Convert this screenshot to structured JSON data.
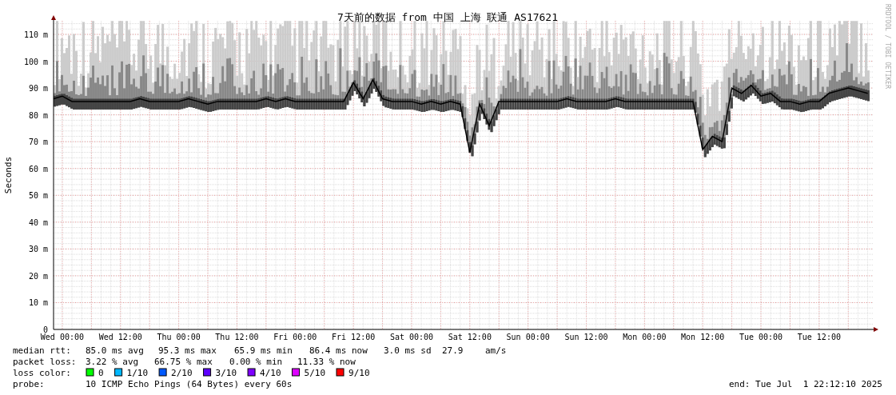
{
  "graph": {
    "title": "7天前的数据 from 中国 上海 联通 AS17621",
    "credit": "RRDTOOL / TOBI OETIKER",
    "chart_data": {
      "type": "line",
      "grid": true,
      "ylabel": "Seconds",
      "ylim": [
        0,
        115
      ],
      "yticks": [
        {
          "value": 0,
          "label": "0"
        },
        {
          "value": 10,
          "label": "10 m"
        },
        {
          "value": 20,
          "label": "20 m"
        },
        {
          "value": 30,
          "label": "30 m"
        },
        {
          "value": 40,
          "label": "40 m"
        },
        {
          "value": 50,
          "label": "50 m"
        },
        {
          "value": 60,
          "label": "60 m"
        },
        {
          "value": 70,
          "label": "70 m"
        },
        {
          "value": 80,
          "label": "80 m"
        },
        {
          "value": 90,
          "label": "90 m"
        },
        {
          "value": 100,
          "label": "100 m"
        },
        {
          "value": 110,
          "label": "110 m"
        }
      ],
      "categories": [
        null,
        "Wed 00:00",
        null,
        null,
        null,
        null,
        null,
        "Wed 12:00",
        null,
        null,
        null,
        null,
        null,
        "Thu 00:00",
        null,
        null,
        null,
        null,
        null,
        "Thu 12:00",
        null,
        null,
        null,
        null,
        null,
        "Fri 00:00",
        null,
        null,
        null,
        null,
        null,
        "Fri 12:00",
        null,
        null,
        null,
        null,
        null,
        "Sat 00:00",
        null,
        null,
        null,
        null,
        null,
        "Sat 12:00",
        null,
        null,
        null,
        null,
        null,
        "Sun 00:00",
        null,
        null,
        null,
        null,
        null,
        "Sun 12:00",
        null,
        null,
        null,
        null,
        null,
        "Mon 00:00",
        null,
        null,
        null,
        null,
        null,
        "Mon 12:00",
        null,
        null,
        null,
        null,
        null,
        "Tue 00:00",
        null,
        null,
        null,
        null,
        null,
        "Tue 12:00",
        null,
        null,
        null,
        null,
        null
      ],
      "series": [
        {
          "color": "#000000",
          "values": [
            86,
            87,
            85,
            85,
            85,
            85,
            85,
            85,
            85,
            86,
            85,
            85,
            85,
            85,
            86,
            85,
            84,
            85,
            85,
            85,
            85,
            85,
            86,
            85,
            86,
            85,
            85,
            85,
            85,
            85,
            85,
            92,
            86,
            93,
            86,
            85,
            85,
            85,
            84,
            85,
            84,
            85,
            84,
            66,
            84,
            76,
            85,
            85,
            85,
            85,
            85,
            85,
            85,
            86,
            85,
            85,
            85,
            85,
            86,
            85,
            85,
            85,
            85,
            85,
            85,
            85,
            85,
            67,
            72,
            70,
            90,
            88,
            91,
            87,
            88,
            85,
            85,
            84,
            85,
            85,
            88,
            89,
            90,
            89,
            88
          ]
        }
      ]
    }
  },
  "legend": {
    "median_rtt": {
      "label": "median rtt:",
      "values": [
        "85.0 ms avg",
        "95.3 ms max",
        "65.9 ms min",
        "86.4 ms now",
        "3.0 ms sd",
        "27.9",
        "am/s"
      ]
    },
    "packet_loss": {
      "label": "packet loss:",
      "values": [
        "3.22 % avg",
        "66.75 % max",
        "0.00 % min",
        "11.33 % now"
      ]
    },
    "loss_color": {
      "label": "loss color:",
      "items": [
        {
          "label": "0",
          "color": "#00ff00"
        },
        {
          "label": "1/10",
          "color": "#00b8ff"
        },
        {
          "label": "2/10",
          "color": "#0059ff"
        },
        {
          "label": "3/10",
          "color": "#5e00ff"
        },
        {
          "label": "4/10",
          "color": "#7e00ff"
        },
        {
          "label": "5/10",
          "color": "#dd00ff"
        },
        {
          "label": "9/10",
          "color": "#ff0000"
        }
      ]
    },
    "probe": {
      "label": "probe:",
      "value": "10 ICMP Echo Pings (64 Bytes) every 60s"
    },
    "end": "end: Tue Jul  1 22:12:10 2025"
  }
}
